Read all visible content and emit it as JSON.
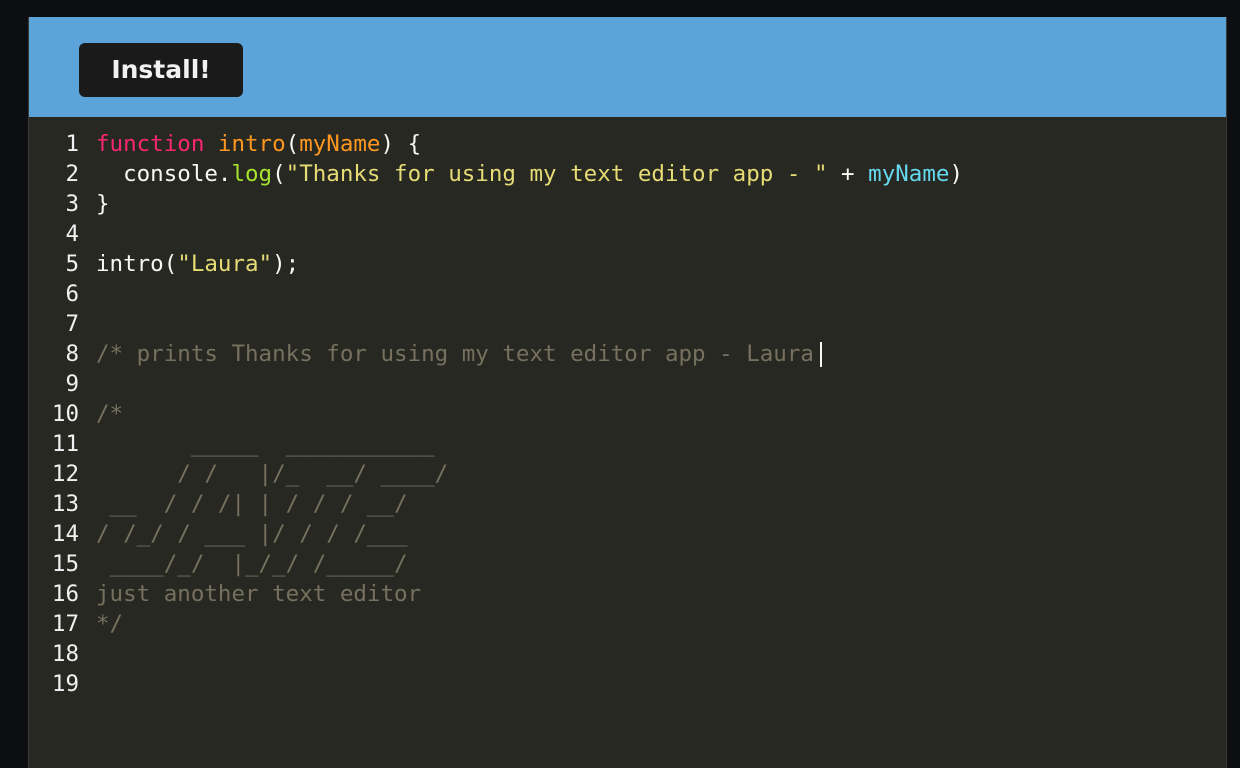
{
  "toolbar": {
    "install_label": "Install!"
  },
  "colors": {
    "header_bg": "#5ca3da",
    "editor_bg": "#272822",
    "keyword": "#f92672",
    "function_name": "#fd971f",
    "string": "#e6db74",
    "property": "#a6e22e",
    "variable": "#66d9ef",
    "comment": "#75715e"
  },
  "editor": {
    "lines": [
      {
        "num": "1",
        "tokens": [
          {
            "text": "function",
            "cls": "kw"
          },
          {
            "text": " ",
            "cls": "pln"
          },
          {
            "text": "intro",
            "cls": "fn"
          },
          {
            "text": "(",
            "cls": "pln"
          },
          {
            "text": "myName",
            "cls": "prm"
          },
          {
            "text": ") {",
            "cls": "pln"
          }
        ]
      },
      {
        "num": "2",
        "tokens": [
          {
            "text": "  console.",
            "cls": "pln"
          },
          {
            "text": "log",
            "cls": "prp"
          },
          {
            "text": "(",
            "cls": "pln"
          },
          {
            "text": "\"Thanks for using my text editor app - \"",
            "cls": "str"
          },
          {
            "text": " + ",
            "cls": "pln"
          },
          {
            "text": "myName",
            "cls": "var"
          },
          {
            "text": ")",
            "cls": "pln"
          }
        ]
      },
      {
        "num": "3",
        "tokens": [
          {
            "text": "}",
            "cls": "pln"
          }
        ]
      },
      {
        "num": "4",
        "tokens": []
      },
      {
        "num": "5",
        "tokens": [
          {
            "text": "intro(",
            "cls": "pln"
          },
          {
            "text": "\"Laura\"",
            "cls": "str"
          },
          {
            "text": ");",
            "cls": "pln"
          }
        ]
      },
      {
        "num": "6",
        "tokens": []
      },
      {
        "num": "7",
        "tokens": []
      },
      {
        "num": "8",
        "tokens": [
          {
            "text": "/* prints Thanks for using my text editor app - Laura",
            "cls": "cm"
          }
        ],
        "caret": true
      },
      {
        "num": "9",
        "tokens": []
      },
      {
        "num": "10",
        "tokens": [
          {
            "text": "/*",
            "cls": "cm"
          }
        ]
      },
      {
        "num": "11",
        "tokens": [
          {
            "text": "       _____  ___________",
            "cls": "cm"
          }
        ]
      },
      {
        "num": "12",
        "tokens": [
          {
            "text": "      / /   |/_  __/ ____/",
            "cls": "cm"
          }
        ]
      },
      {
        "num": "13",
        "tokens": [
          {
            "text": " __  / / /| | / / / __/",
            "cls": "cm"
          }
        ]
      },
      {
        "num": "14",
        "tokens": [
          {
            "text": "/ /_/ / ___ |/ / / /___",
            "cls": "cm"
          }
        ]
      },
      {
        "num": "15",
        "tokens": [
          {
            "text": " ____/_/  |_/_/ /_____/",
            "cls": "cm"
          }
        ]
      },
      {
        "num": "16",
        "tokens": [
          {
            "text": "just another text editor",
            "cls": "cm"
          }
        ]
      },
      {
        "num": "17",
        "tokens": [
          {
            "text": "*/",
            "cls": "cm"
          }
        ]
      },
      {
        "num": "18",
        "tokens": []
      },
      {
        "num": "19",
        "tokens": []
      }
    ]
  }
}
